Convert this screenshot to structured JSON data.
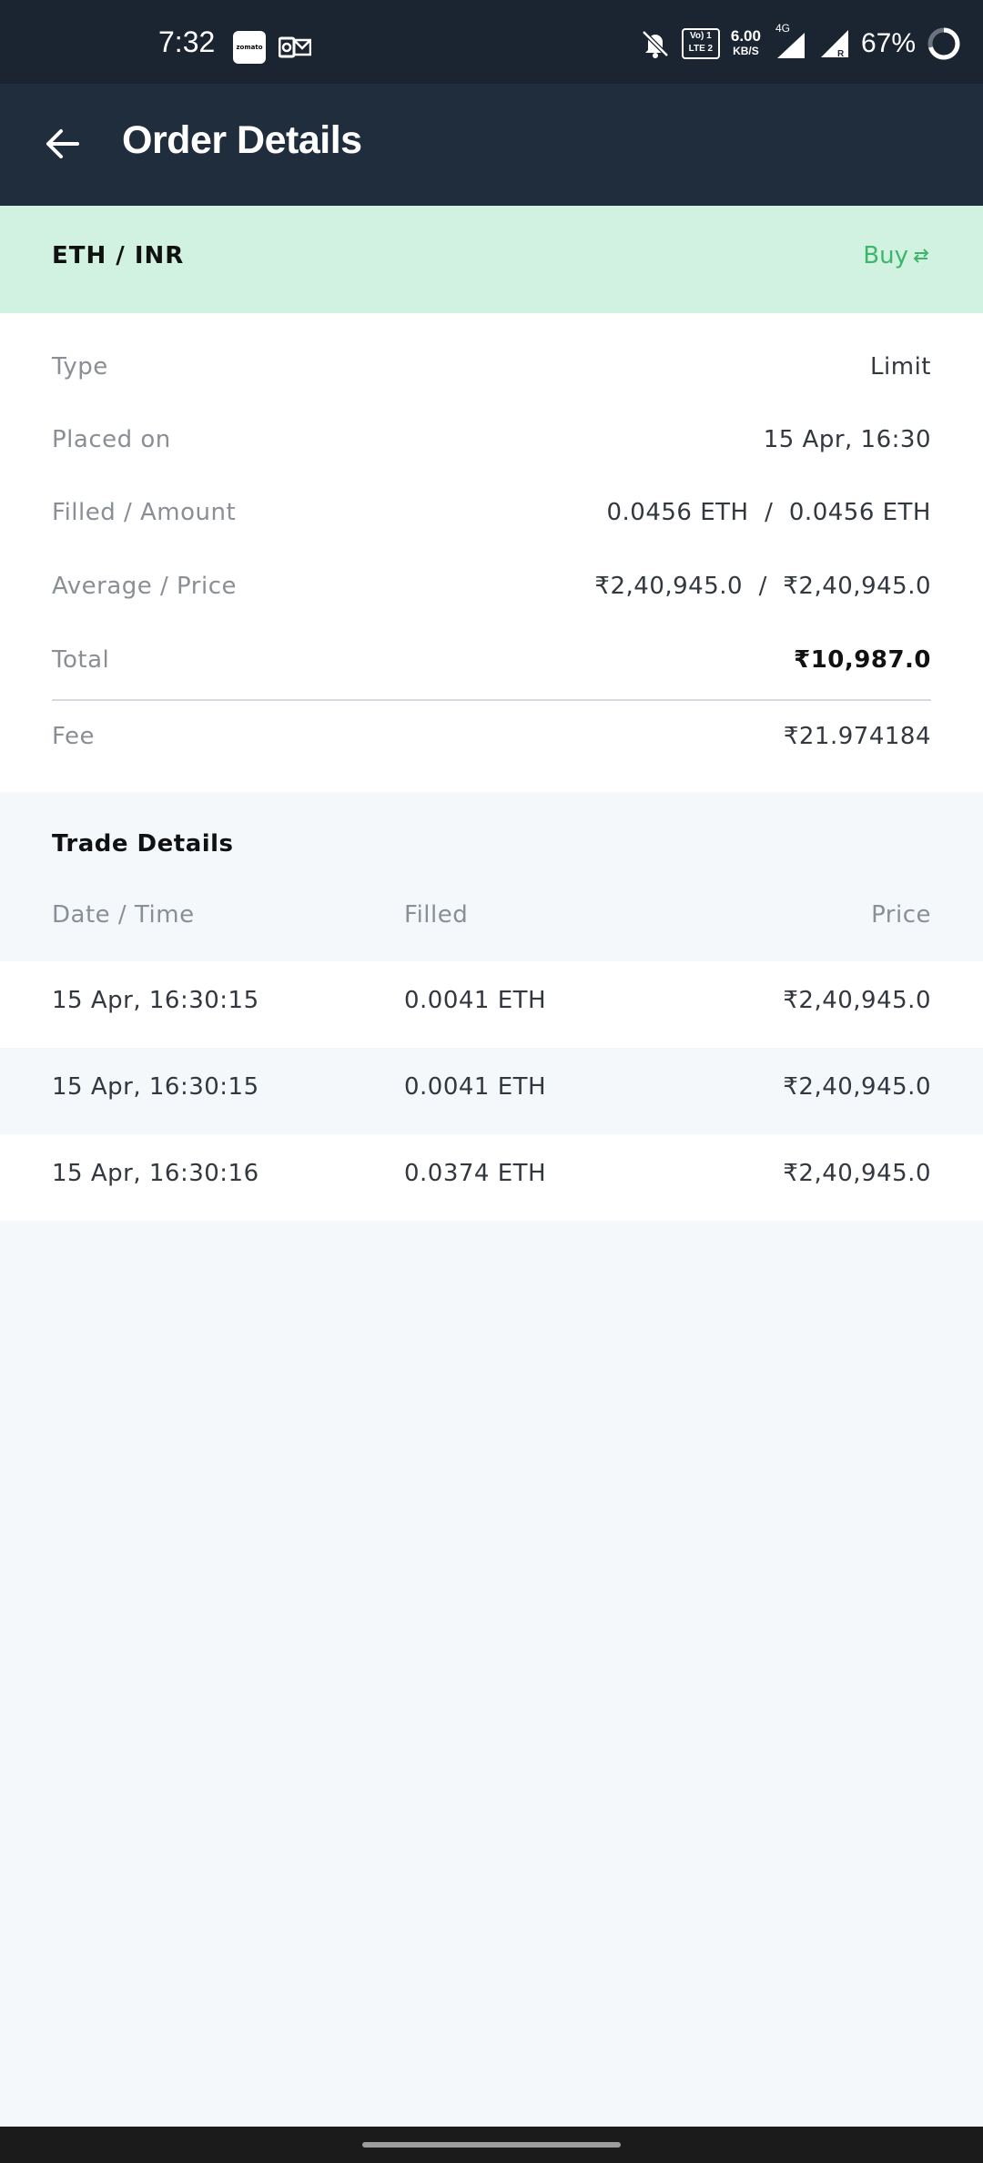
{
  "status_bar": {
    "time": "7:32",
    "notif_zomato_text": "zomato",
    "volte_text_top": "Vo) 1",
    "volte_text_bottom": "LTE 2",
    "speed_value": "6.00",
    "speed_unit": "KB/S",
    "network_type": "4G",
    "battery_percent": "67%",
    "icons": [
      "zomato-notification-icon",
      "outlook-notification-icon",
      "mute-icon",
      "volte-icon",
      "signal-icon",
      "signal-roaming-icon",
      "battery-icon"
    ]
  },
  "app_bar": {
    "title": "Order Details",
    "back_icon": "arrow-left-icon"
  },
  "pair": {
    "name": "ETH / INR",
    "side": "Buy",
    "side_icon": "swap-arrows-icon",
    "side_color": "#3cb66a",
    "banner_color": "#d2f2e1"
  },
  "details": [
    {
      "label": "Type",
      "value": "Limit"
    },
    {
      "label": "Placed on",
      "value": "15 Apr, 16:30"
    },
    {
      "label": "Filled / Amount",
      "value": "0.0456 ETH  /  0.0456 ETH"
    },
    {
      "label": "Average / Price",
      "value": "₹2,40,945.0  /  ₹2,40,945.0"
    },
    {
      "label": "Total",
      "value": "₹10,987.0"
    },
    {
      "label": "Fee",
      "value": "₹21.974184"
    }
  ],
  "trade_details": {
    "title": "Trade Details",
    "columns": [
      "Date / Time",
      "Filled",
      "Price"
    ],
    "rows": [
      {
        "date": "15 Apr, 16:30:15",
        "filled": "0.0041 ETH",
        "price": "₹2,40,945.0"
      },
      {
        "date": "15 Apr, 16:30:15",
        "filled": "0.0041 ETH",
        "price": "₹2,40,945.0"
      },
      {
        "date": "15 Apr, 16:30:16",
        "filled": "0.0374 ETH",
        "price": "₹2,40,945.0"
      }
    ]
  }
}
